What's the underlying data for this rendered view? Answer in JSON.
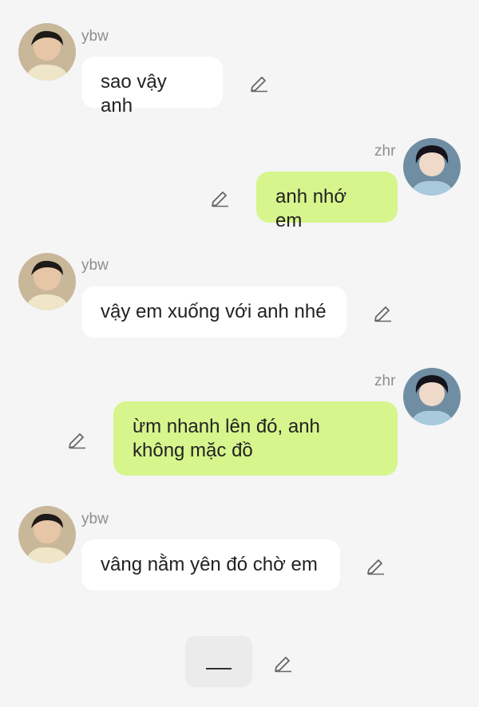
{
  "messages": [
    {
      "sender": "ybw",
      "side": "left",
      "text": "sao vậy anh"
    },
    {
      "sender": "zhr",
      "side": "right",
      "text": "anh nhớ em"
    },
    {
      "sender": "ybw",
      "side": "left",
      "text": "vậy em xuống với anh nhé"
    },
    {
      "sender": "zhr",
      "side": "right",
      "line1": "ừm nhanh lên đó, anh",
      "line2": "không mặc đồ"
    },
    {
      "sender": "ybw",
      "side": "left",
      "text": "vâng nằm yên đó chờ em"
    }
  ],
  "composer": {
    "draft": "___"
  },
  "icons": {
    "edit": "pencil-edit-icon",
    "avatar_ybw": "avatar-ybw",
    "avatar_zhr": "avatar-zhr"
  },
  "colors": {
    "background": "#f5f5f5",
    "incoming_bubble": "#ffffff",
    "outgoing_bubble": "#d6f58c",
    "sender_name": "#8e8e8e"
  }
}
